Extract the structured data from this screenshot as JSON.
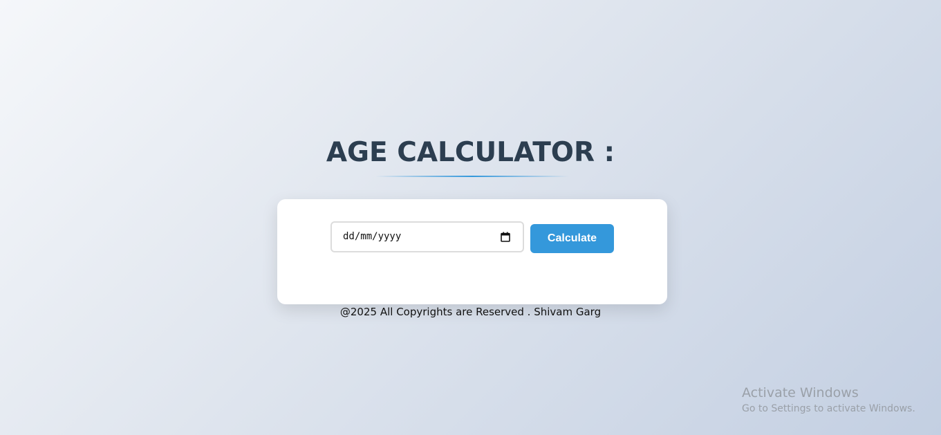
{
  "header": {
    "title": "AGE CALCULATOR :"
  },
  "form": {
    "date_placeholder": "dd/mm/yyyy",
    "calculate_label": "Calculate"
  },
  "footer": {
    "text": "@2025 All Copyrights are Reserved . Shivam Garg"
  },
  "watermark": {
    "title": "Activate Windows",
    "subtitle": "Go to Settings to activate Windows."
  },
  "icons": {
    "date_picker": "calendar-icon"
  },
  "colors": {
    "accent": "#3498db",
    "title": "#2c3e50"
  }
}
